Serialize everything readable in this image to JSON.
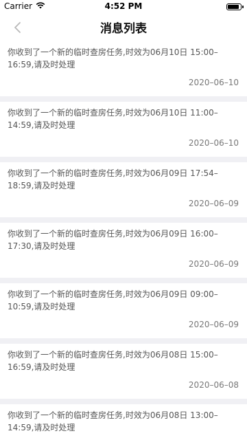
{
  "status_bar": {
    "carrier": "Carrier",
    "time": "4:52 PM"
  },
  "nav": {
    "title": "消息列表",
    "back_icon": "chevron-left-icon"
  },
  "messages": [
    {
      "text": "你收到了一个新的临时查房任务,时效为06月10日 15:00–16:59,请及时处理",
      "date": "2020–06–10"
    },
    {
      "text": "你收到了一个新的临时查房任务,时效为06月10日 11:00–14:59,请及时处理",
      "date": "2020–06–10"
    },
    {
      "text": "你收到了一个新的临时查房任务,时效为06月09日 17:54–18:59,请及时处理",
      "date": "2020–06–09"
    },
    {
      "text": "你收到了一个新的临时查房任务,时效为06月09日 16:00–17:30,请及时处理",
      "date": "2020–06–09"
    },
    {
      "text": "你收到了一个新的临时查房任务,时效为06月09日 09:00–10:59,请及时处理",
      "date": "2020–06–09"
    },
    {
      "text": "你收到了一个新的临时查房任务,时效为06月08日 15:00–16:59,请及时处理",
      "date": "2020–06–08"
    },
    {
      "text": "你收到了一个新的临时查房任务,时效为06月08日 13:00–14:59,请及时处理",
      "date": ""
    }
  ]
}
